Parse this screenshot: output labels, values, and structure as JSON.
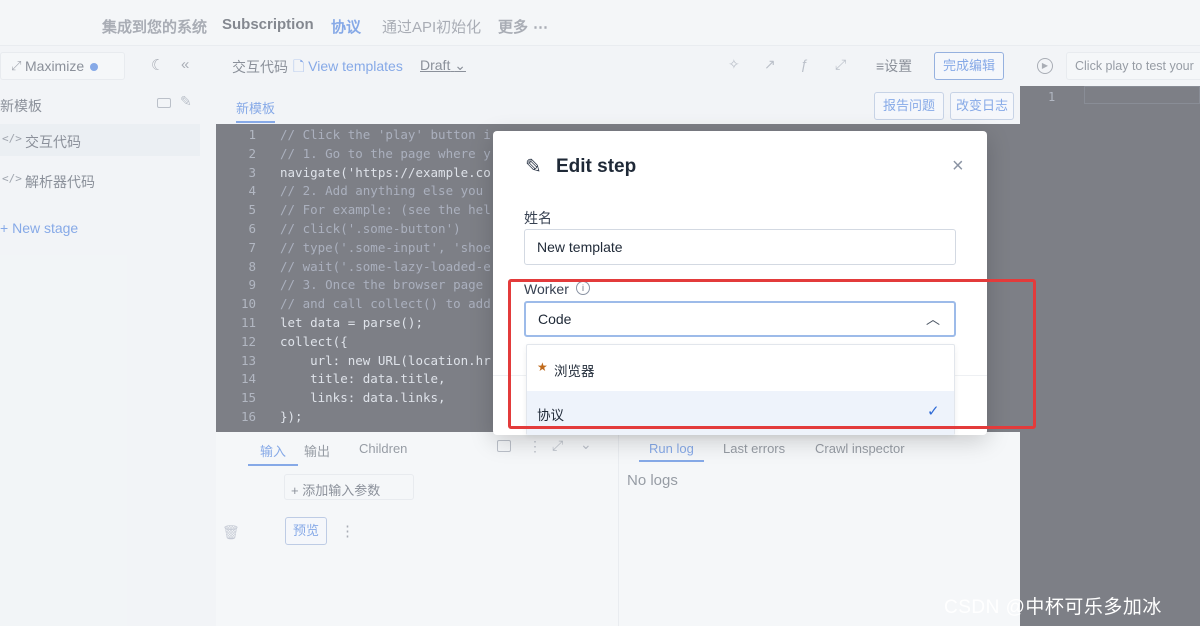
{
  "topnav": {
    "tabs": [
      {
        "label": "集成到您的系统"
      },
      {
        "label": "Subscription"
      },
      {
        "label": "协议"
      },
      {
        "label": "通过API初始化"
      },
      {
        "label": "更多"
      }
    ]
  },
  "sidebar": {
    "maximize_label": "Maximize",
    "section_title": "新模板",
    "items": [
      {
        "label": "交互代码"
      },
      {
        "label": "解析器代码"
      }
    ],
    "new_stage": "New stage"
  },
  "editor": {
    "title": "交互代码",
    "view_templates": "View templates",
    "draft": "Draft",
    "settings": "设置",
    "finish_edit": "完成编辑",
    "file_tab": "新模板",
    "report_issue": "报告问题",
    "changelog": "改变日志",
    "lines": [
      "// Click the 'play' button i",
      "// 1. Go to the page where y",
      "navigate('https://example.co",
      "// 2. Add anything else you ",
      "// For example: (see the hel",
      "// click('.some-button')",
      "// type('.some-input', 'shoe",
      "// wait('.some-lazy-loaded-e",
      "// 3. Once the browser page ",
      "// and call collect() to add",
      "let data = parse();",
      "collect({",
      "    url: new URL(location.hr",
      "    title: data.title,",
      "    links: data.links,",
      "});"
    ]
  },
  "bottom_left": {
    "tabs": [
      "输入",
      "输出",
      "Children"
    ],
    "add_param": "添加输入参数",
    "preview": "预览"
  },
  "bottom_right": {
    "tabs": [
      "Run log",
      "Last errors",
      "Crawl inspector"
    ],
    "no_logs": "No logs"
  },
  "right_panel": {
    "placeholder": "Click play to test your",
    "line_number": "1"
  },
  "modal": {
    "title": "Edit step",
    "name_label": "姓名",
    "name_value": "New template",
    "worker_label": "Worker",
    "worker_value": "Code",
    "options": [
      {
        "label": "浏览器",
        "starred": true
      },
      {
        "label": "协议",
        "selected": true
      }
    ]
  },
  "watermark": "CSDN @中杯可乐多加冰",
  "colors": {
    "accent": "#2f6bd6",
    "highlight": "#e33b3b",
    "star": "#c06a1c"
  }
}
